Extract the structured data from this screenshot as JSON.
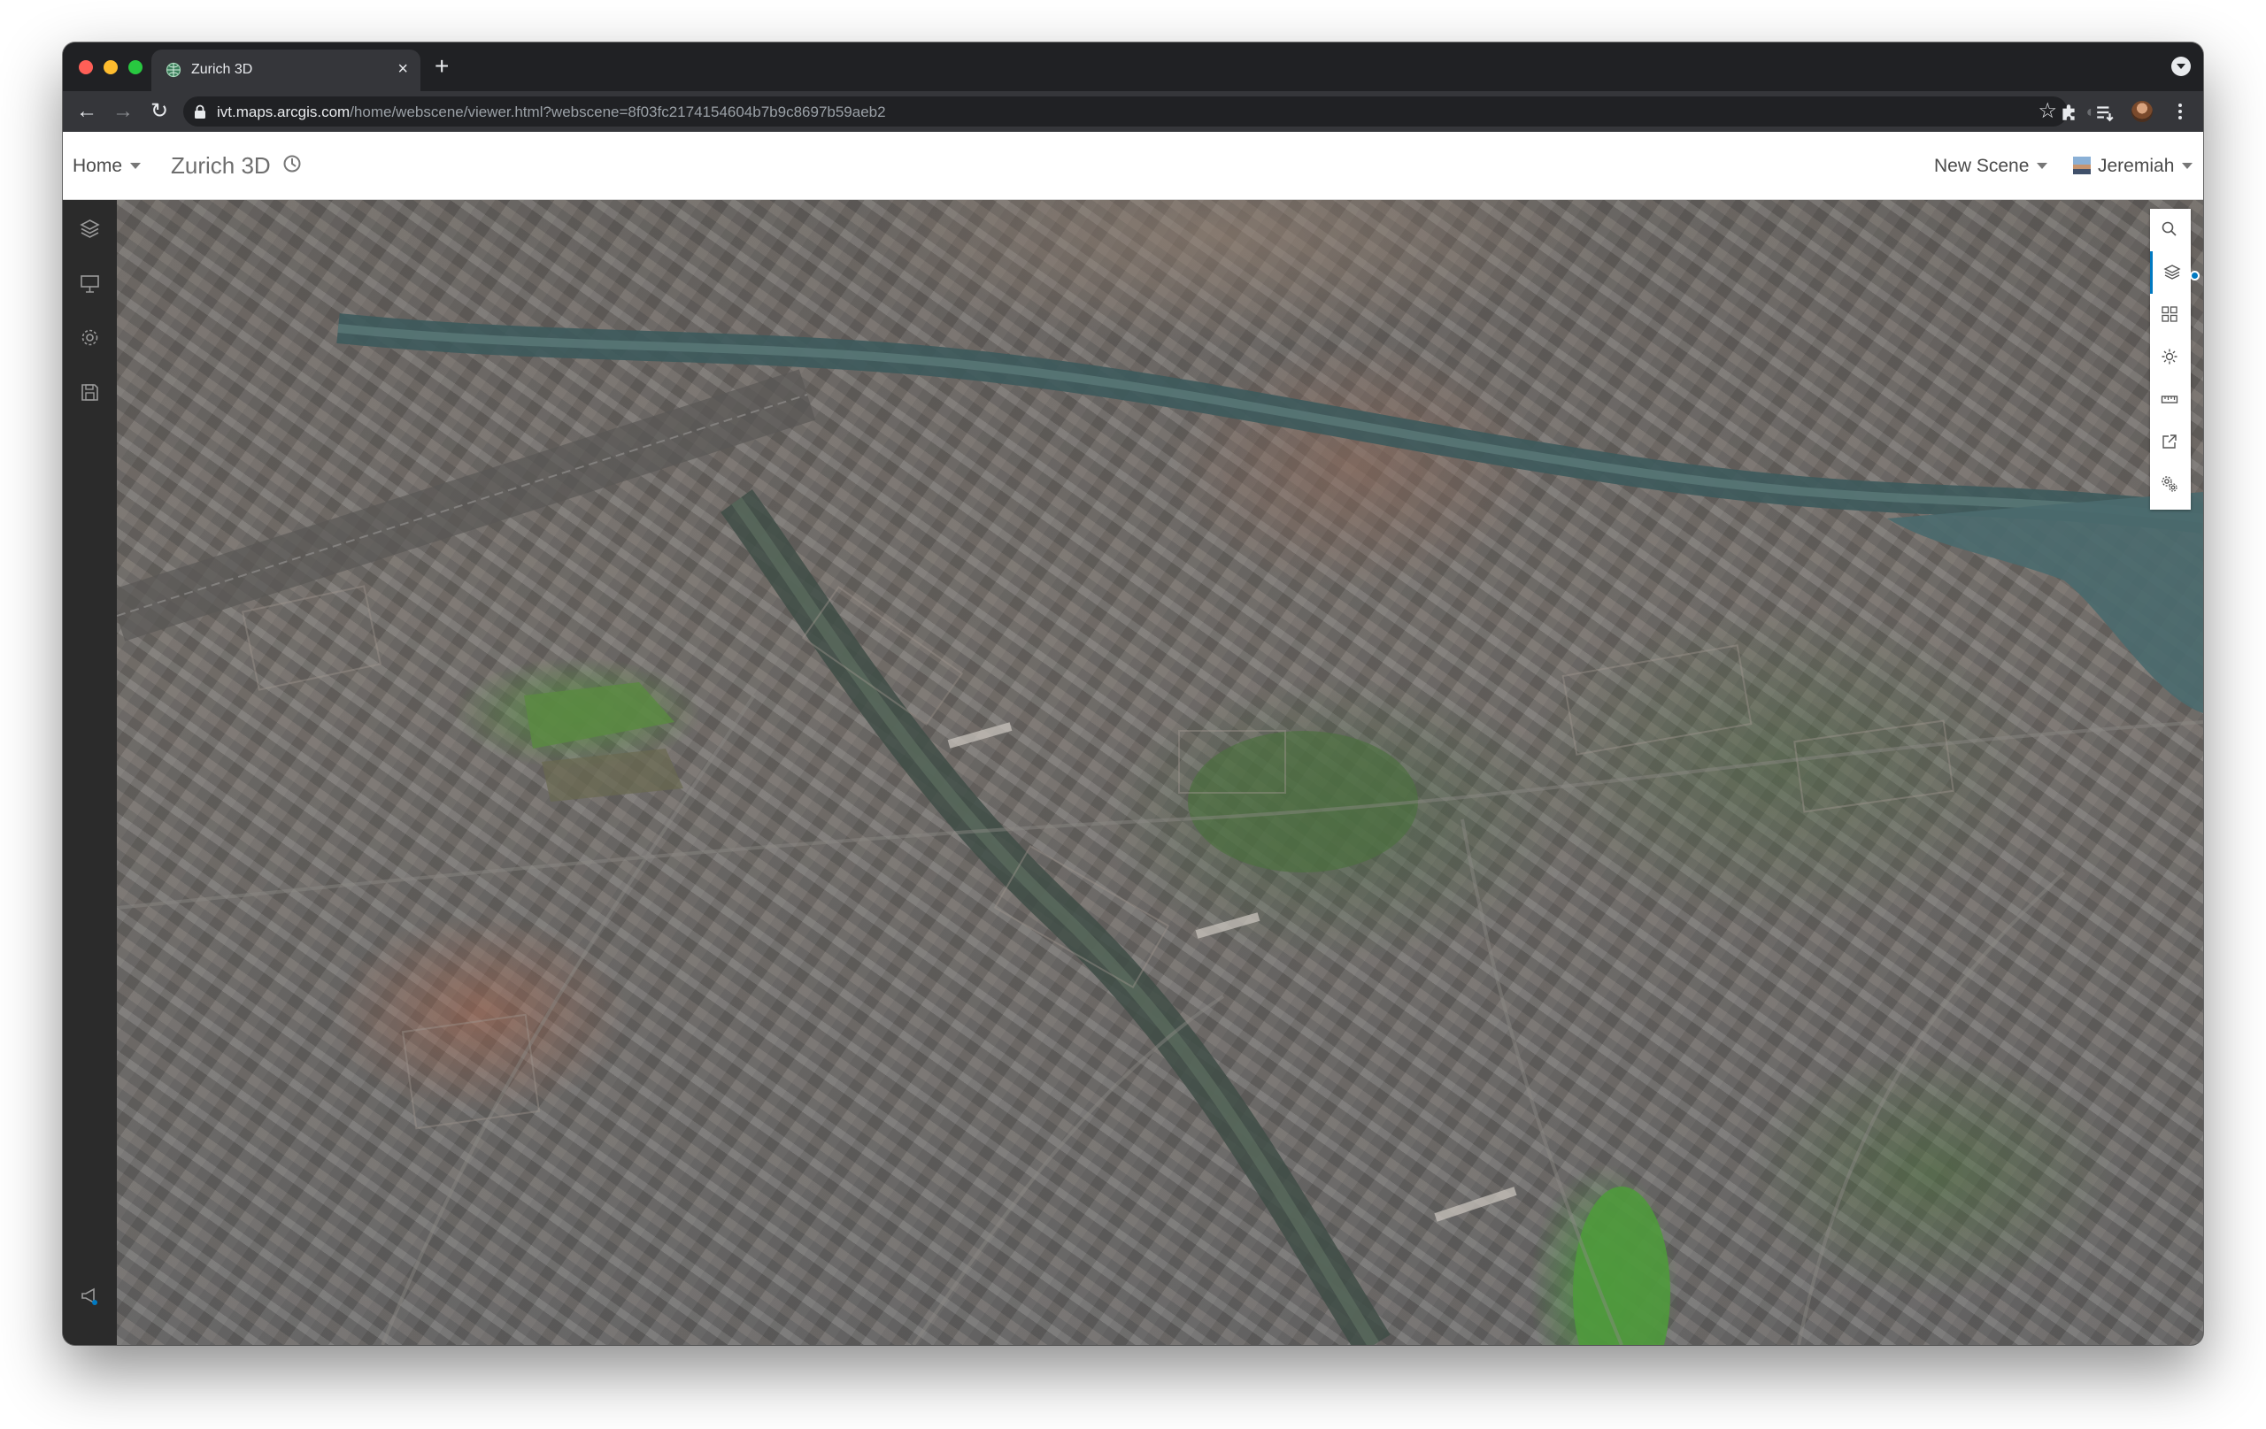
{
  "browser": {
    "tab": {
      "title": "Zurich 3D",
      "close_glyph": "×"
    },
    "new_tab_glyph": "+",
    "url": {
      "host": "ivt.maps.arcgis.com",
      "path": "/home/webscene/viewer.html?webscene=8f03fc2174154604b7b9c8697b59aeb2"
    },
    "icons": [
      "back-arrow-icon",
      "forward-arrow-icon",
      "reload-icon",
      "lock-icon",
      "bookmark-star-icon",
      "extension-icon",
      "puzzle-icon",
      "reading-list-icon",
      "profile-avatar",
      "kebab-menu-icon"
    ]
  },
  "app": {
    "home_label": "Home",
    "scene_title": "Zurich 3D",
    "new_scene_label": "New Scene",
    "user_name": "Jeremiah"
  },
  "left_rail": {
    "items": [
      "layers-icon",
      "slides-icon",
      "settings-icon",
      "save-icon"
    ],
    "bottom": [
      "announcement-icon",
      "expand-icon"
    ],
    "expand_glyph": "»"
  },
  "widgets": {
    "items": [
      "search-icon",
      "layers-icon",
      "basemap-gallery-icon",
      "daylight-icon",
      "measure-icon",
      "share-icon",
      "settings-cog-icon"
    ],
    "active": "layers-icon"
  },
  "colors": {
    "accent": "#0079c1",
    "browser_frame": "#202124",
    "browser_toolbar": "#35363a",
    "rail": "#2b2b2b"
  }
}
